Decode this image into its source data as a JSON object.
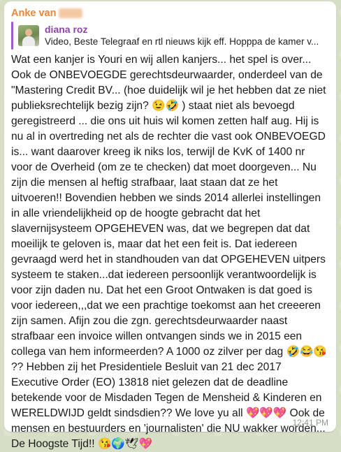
{
  "message": {
    "sender_name": "Anke van",
    "reply": {
      "name": "diana roz",
      "snippet": "Video, Beste Telegraaf en rtl nieuws kijk eff. Hopppa de kamer v..."
    },
    "text": "Wat een kanjer  is Youri en wij allen kanjers... het spel is over... Ook de ONBEVOEGDE gerechtsdeurwaarder, onderdeel van de \"Mastering Credit BV... (hoe duidelijk wil je het hebben dat ze niet publieksrechtelijk bezig zijn? 😉🤣 ) staat niet als bevoegd geregistreerd ... die ons uit huis wil komen zetten half aug.  Hij is nu al in overtreding net als de rechter die vast ook ONBEVOEGD is... want daarover kreeg ik niks los, terwijl de KvK of 1400 nr voor de Overheid (om ze te checken) dat moet doorgeven... Nu zijn die mensen al heftig strafbaar, laat staan dat ze het uitvoeren!! Bovendien hebben we sinds 2014 allerlei instellingen in alle vriendelijkheid op de hoogte gebracht dat het slavernijsysteem OPGEHEVEN was, dat we begrepen dat dat moeilijk te geloven is, maar dat het een feit is. Dat iedereen gevraagd werd het in standhouden van dat OPGEHEVEN uitpers systeem te staken...dat iedereen persoonlijk verantwoordelijk is voor zijn daden nu. Dat het een Groot Ontwaken is dat goed is voor iedereen,,,dat we een prachtige toekomst aan  het creeeren zijn samen.  Afijn zou die zgn. gerechtsdeurwaarder naast strafbaar een invoice willen ontvangen sinds we in 2015 een collega van hem informeerden? A 1000 oz zilver per dag 🤣😂😘 ?? Hebben zij het Presidentiele Besluit van 21 dec 2017 Executive Order (EO) 13818 niet gelezen dat de deadline betekende voor de Misdaden Tegen de Mensheid & Kinderen en WERELDWIJD geldt sindsdien?? We love yu all 💖💖💖 Ook de mensen en bestuurders en 'journalisten' die NU wakker worden... De Hoogste Tijd!! 😘🌍🕊💖",
    "time": "12:41 PM"
  },
  "colors": {
    "sender": "#e6873a",
    "reply_name": "#8e44ad",
    "reply_bar": "#9b59d0",
    "time": "#8c9c8a"
  }
}
